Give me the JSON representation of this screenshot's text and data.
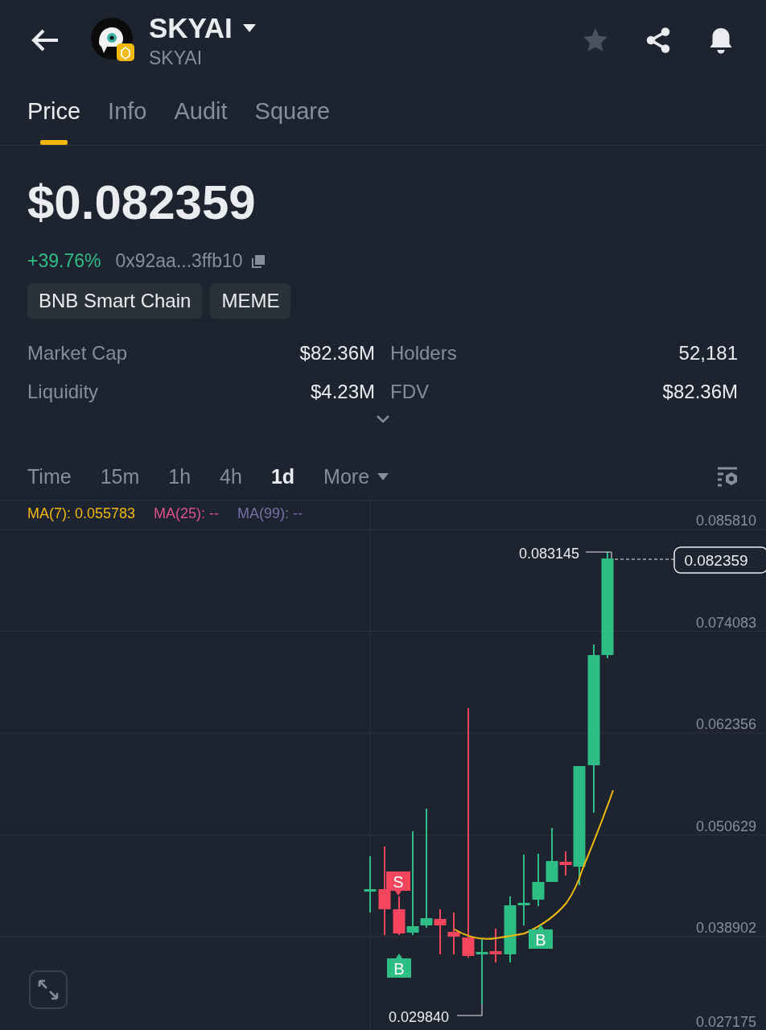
{
  "header": {
    "name": "SKYAI",
    "symbol": "SKYAI"
  },
  "tabs": [
    {
      "label": "Price",
      "selected": true
    },
    {
      "label": "Info",
      "selected": false
    },
    {
      "label": "Audit",
      "selected": false
    },
    {
      "label": "Square",
      "selected": false
    }
  ],
  "price": "$0.082359",
  "change": "+39.76%",
  "address": "0x92aa...3ffb10",
  "tags": [
    "BNB Smart Chain",
    "MEME"
  ],
  "stats": [
    {
      "label": "Market Cap",
      "value": "$82.36M"
    },
    {
      "label": "Holders",
      "value": "52,181"
    },
    {
      "label": "Liquidity",
      "value": "$4.23M"
    },
    {
      "label": "FDV",
      "value": "$82.36M"
    }
  ],
  "intervals": [
    {
      "label": "Time",
      "selected": false,
      "kind": "plain"
    },
    {
      "label": "15m",
      "selected": false,
      "kind": "plain"
    },
    {
      "label": "1h",
      "selected": false,
      "kind": "plain"
    },
    {
      "label": "4h",
      "selected": false,
      "kind": "plain"
    },
    {
      "label": "1d",
      "selected": true,
      "kind": "plain"
    },
    {
      "label": "More",
      "selected": false,
      "kind": "dropdown"
    }
  ],
  "chart": {
    "ma_legend": [
      {
        "text": "MA(7): 0.055783",
        "color": "#f0b90b"
      },
      {
        "text": "MA(25): --",
        "color": "#d9538a"
      },
      {
        "text": "MA(99): --",
        "color": "#7a6fa8"
      }
    ],
    "y_labels": [
      "0.085810",
      "0.074083",
      "0.062356",
      "0.050629",
      "0.038902",
      "0.027175"
    ],
    "high_label": "0.083145",
    "low_label": "0.029840",
    "current_price": "0.082359",
    "markers": [
      {
        "label": "S",
        "kind": "sell"
      },
      {
        "label": "B",
        "kind": "buy"
      },
      {
        "label": "B",
        "kind": "buy"
      }
    ]
  }
}
